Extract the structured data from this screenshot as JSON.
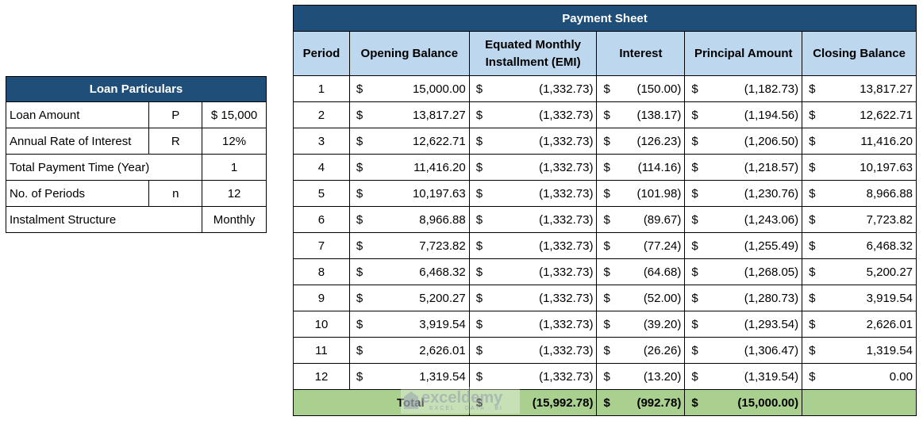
{
  "loan_particulars": {
    "title": "Loan Particulars",
    "rows": [
      {
        "label": "Loan Amount",
        "symbol": "P",
        "value": "$ 15,000"
      },
      {
        "label": "Annual Rate of Interest",
        "symbol": "R",
        "value": "12%"
      },
      {
        "label": "Total Payment Time (Year)",
        "symbol": "",
        "value": "1"
      },
      {
        "label": "No. of Periods",
        "symbol": "n",
        "value": "12"
      },
      {
        "label": "Instalment Structure",
        "symbol": "",
        "value": "Monthly"
      }
    ]
  },
  "payment_sheet": {
    "title": "Payment Sheet",
    "currency_symbol": "$",
    "columns": [
      "Period",
      "Opening Balance",
      "Equated Monthly Installment (EMI)",
      "Interest",
      "Principal Amount",
      "Closing Balance"
    ],
    "rows": [
      {
        "period": "1",
        "opening": "15,000.00",
        "emi": "(1,332.73)",
        "interest": "(150.00)",
        "principal": "(1,182.73)",
        "closing": "13,817.27"
      },
      {
        "period": "2",
        "opening": "13,817.27",
        "emi": "(1,332.73)",
        "interest": "(138.17)",
        "principal": "(1,194.56)",
        "closing": "12,622.71"
      },
      {
        "period": "3",
        "opening": "12,622.71",
        "emi": "(1,332.73)",
        "interest": "(126.23)",
        "principal": "(1,206.50)",
        "closing": "11,416.20"
      },
      {
        "period": "4",
        "opening": "11,416.20",
        "emi": "(1,332.73)",
        "interest": "(114.16)",
        "principal": "(1,218.57)",
        "closing": "10,197.63"
      },
      {
        "period": "5",
        "opening": "10,197.63",
        "emi": "(1,332.73)",
        "interest": "(101.98)",
        "principal": "(1,230.76)",
        "closing": "8,966.88"
      },
      {
        "period": "6",
        "opening": "8,966.88",
        "emi": "(1,332.73)",
        "interest": "(89.67)",
        "principal": "(1,243.06)",
        "closing": "7,723.82"
      },
      {
        "period": "7",
        "opening": "7,723.82",
        "emi": "(1,332.73)",
        "interest": "(77.24)",
        "principal": "(1,255.49)",
        "closing": "6,468.32"
      },
      {
        "period": "8",
        "opening": "6,468.32",
        "emi": "(1,332.73)",
        "interest": "(64.68)",
        "principal": "(1,268.05)",
        "closing": "5,200.27"
      },
      {
        "period": "9",
        "opening": "5,200.27",
        "emi": "(1,332.73)",
        "interest": "(52.00)",
        "principal": "(1,280.73)",
        "closing": "3,919.54"
      },
      {
        "period": "10",
        "opening": "3,919.54",
        "emi": "(1,332.73)",
        "interest": "(39.20)",
        "principal": "(1,293.54)",
        "closing": "2,626.01"
      },
      {
        "period": "11",
        "opening": "2,626.01",
        "emi": "(1,332.73)",
        "interest": "(26.26)",
        "principal": "(1,306.47)",
        "closing": "1,319.54"
      },
      {
        "period": "12",
        "opening": "1,319.54",
        "emi": "(1,332.73)",
        "interest": "(13.20)",
        "principal": "(1,319.54)",
        "closing": "0.00"
      }
    ],
    "total": {
      "label": "Total",
      "emi": "(15,992.78)",
      "interest": "(992.78)",
      "principal": "(15,000.00)"
    }
  },
  "watermark": {
    "name": "exceldemy",
    "tagline": "EXCEL · DATA · BI"
  }
}
